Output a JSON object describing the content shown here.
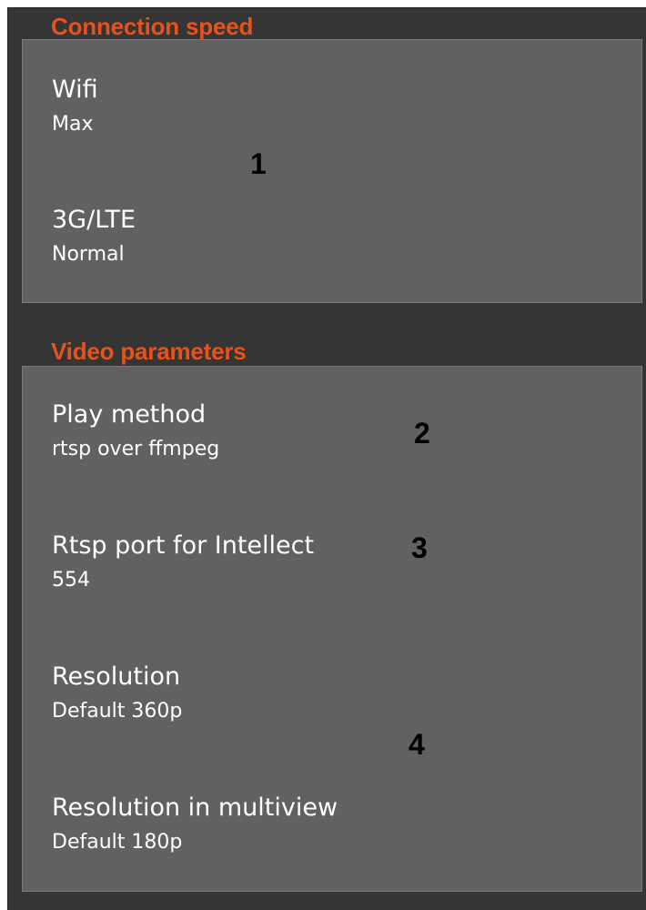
{
  "sections": {
    "connection": {
      "title": "Connection speed",
      "items": [
        {
          "title": "Wifi",
          "value": "Max"
        },
        {
          "title": "3G/LTE",
          "value": "Normal"
        }
      ]
    },
    "video": {
      "title": "Video parameters",
      "items": [
        {
          "title": "Play method",
          "value": "rtsp over ffmpeg"
        },
        {
          "title": "Rtsp port for Intellect",
          "value": "554"
        },
        {
          "title": "Resolution",
          "value": "Default 360p"
        },
        {
          "title": "Resolution in multiview",
          "value": "Default 180p"
        }
      ]
    }
  },
  "callouts": [
    "1",
    "2",
    "3",
    "4"
  ],
  "colors": {
    "background": "#353535",
    "panel": "#616161",
    "section_header": "#e9511b",
    "text": "#ffffff",
    "callout": "#000000"
  }
}
